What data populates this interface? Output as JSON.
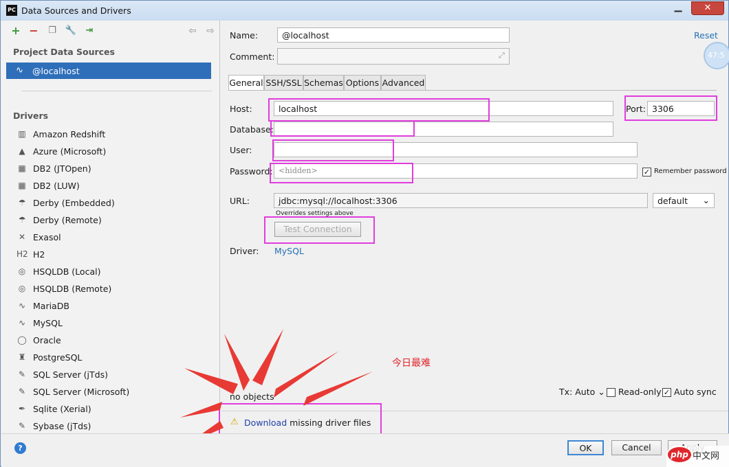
{
  "window": {
    "title": "Data Sources and Drivers",
    "app_icon": "PC"
  },
  "left": {
    "section_sources": "Project Data Sources",
    "selected_source": "@localhost",
    "section_drivers": "Drivers",
    "drivers": [
      {
        "label": "Amazon Redshift",
        "icon": "▥"
      },
      {
        "label": "Azure (Microsoft)",
        "icon": "▲"
      },
      {
        "label": "DB2 (JTOpen)",
        "icon": "▦"
      },
      {
        "label": "DB2 (LUW)",
        "icon": "▦"
      },
      {
        "label": "Derby (Embedded)",
        "icon": "☂"
      },
      {
        "label": "Derby (Remote)",
        "icon": "☂"
      },
      {
        "label": "Exasol",
        "icon": "✕"
      },
      {
        "label": "H2",
        "icon": "H2"
      },
      {
        "label": "HSQLDB (Local)",
        "icon": "◎"
      },
      {
        "label": "HSQLDB (Remote)",
        "icon": "◎"
      },
      {
        "label": "MariaDB",
        "icon": "∿"
      },
      {
        "label": "MySQL",
        "icon": "∿"
      },
      {
        "label": "Oracle",
        "icon": "◯"
      },
      {
        "label": "PostgreSQL",
        "icon": "♜"
      },
      {
        "label": "SQL Server (jTds)",
        "icon": "✎"
      },
      {
        "label": "SQL Server (Microsoft)",
        "icon": "✎"
      },
      {
        "label": "Sqlite (Xerial)",
        "icon": "✒"
      },
      {
        "label": "Sybase (jTds)",
        "icon": "✎"
      }
    ]
  },
  "form": {
    "name_label": "Name:",
    "name_value": "@localhost",
    "reset_label": "Reset",
    "comment_label": "Comment:",
    "tabs": [
      "General",
      "SSH/SSL",
      "Schemas",
      "Options",
      "Advanced"
    ],
    "host_label": "Host:",
    "host_value": "localhost",
    "port_label": "Port:",
    "port_value": "3306",
    "database_label": "Database:",
    "user_label": "User:",
    "password_label": "Password:",
    "password_placeholder": "<hidden>",
    "remember_password": "Remember password",
    "url_label": "URL:",
    "url_value": "jdbc:mysql://localhost:3306",
    "url_mode": "default",
    "url_hint": "Overrides settings above",
    "test_connection": "Test Connection",
    "driver_label": "Driver:",
    "driver_value": "MySQL",
    "no_objects": "no objects",
    "tx_label": "Tx: Auto",
    "readonly_label": "Read-only",
    "autosync_label": "Auto sync",
    "download_link": "Download",
    "download_rest": " missing driver files"
  },
  "buttons": {
    "ok": "OK",
    "cancel": "Cancel",
    "apply": "Apply"
  },
  "annotation": {
    "note": "今日最难"
  },
  "overlay": {
    "timer": "47:5",
    "watermark_php": "php",
    "watermark_cn": "中文网"
  },
  "colors": {
    "selection": "#2f6fba",
    "highlight": "#e13cdd",
    "arrow": "#e83a35",
    "link": "#2470b3"
  }
}
